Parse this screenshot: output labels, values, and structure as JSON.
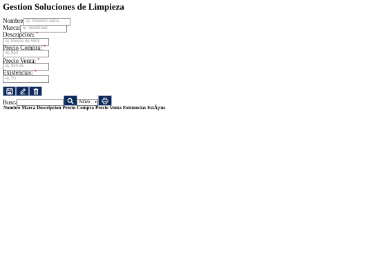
{
  "title": "Gestion Soluciones de Limpieza",
  "required_mark": "*",
  "form": {
    "nombre_label": "Nombre:",
    "nombre_placeholder": "ej. Solución saina",
    "marca_label": "Marca:",
    "marca_placeholder": "ej. ViewGood",
    "descripcion_label": "Descripcion:",
    "descripcion_placeholder": "ej. Botella de 50ml",
    "precio_compra_label": "Precio Compra:",
    "precio_compra_placeholder": "ej. $30",
    "precio_venta_label": "Precio Venta:",
    "precio_venta_placeholder": "ej. $40.35",
    "existencias_label": "Existencias:",
    "existencias_placeholder": "ej. 70"
  },
  "actions": {
    "save_icon": "save-icon",
    "edit_icon": "pencil-icon",
    "delete_icon": "trash-icon"
  },
  "search": {
    "label": "Buscar",
    "value": "",
    "status_selected": "Activo",
    "search_icon": "magnifier-icon",
    "print_icon": "printer-icon"
  },
  "table": {
    "headers": [
      "Nombre",
      "Marca",
      "Descripcion",
      "Precio Compra",
      "Precio Venta",
      "Existencias",
      "EstÃ¡tus"
    ]
  },
  "colors": {
    "button_bg": "#0c2a5b",
    "required": "#cc0000"
  }
}
